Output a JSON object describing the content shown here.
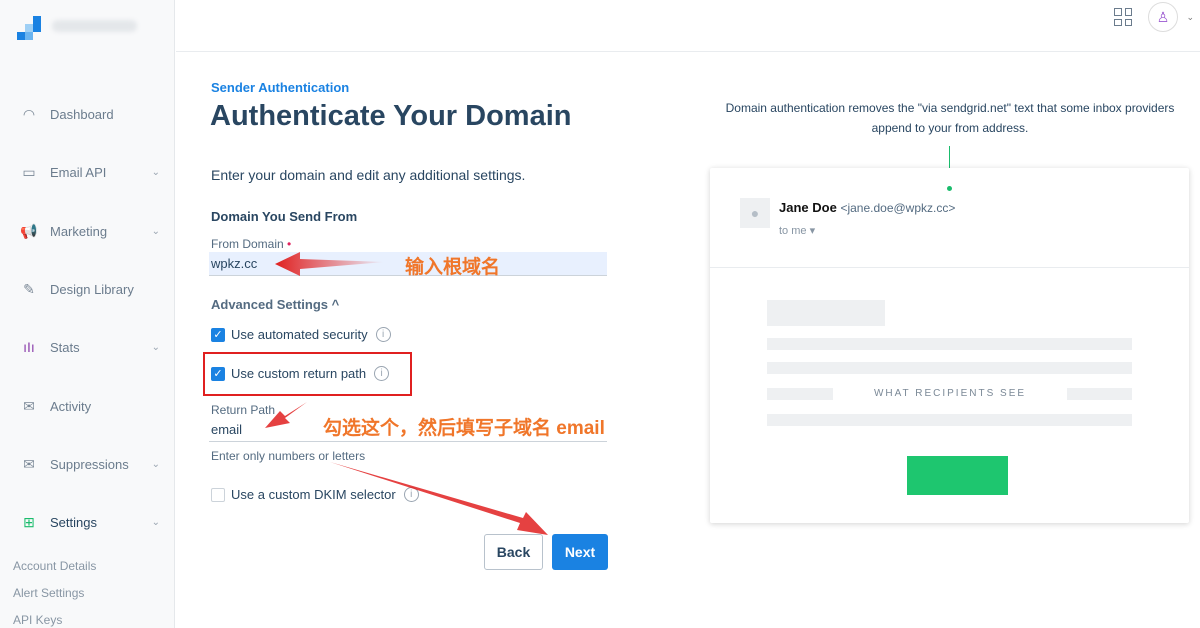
{
  "sidebar": {
    "items": [
      {
        "label": "Dashboard",
        "icon": "gauge-icon"
      },
      {
        "label": "Email API",
        "icon": "terminal-icon"
      },
      {
        "label": "Marketing",
        "icon": "megaphone-icon"
      },
      {
        "label": "Design Library",
        "icon": "pencil-ruler-icon"
      },
      {
        "label": "Stats",
        "icon": "bar-chart-icon"
      },
      {
        "label": "Activity",
        "icon": "envelope-search-icon"
      },
      {
        "label": "Suppressions",
        "icon": "envelope-block-icon"
      },
      {
        "label": "Settings",
        "icon": "sliders-icon"
      }
    ],
    "subitems": [
      "Account Details",
      "Alert Settings",
      "API Keys"
    ]
  },
  "page": {
    "eyebrow": "Sender Authentication",
    "title": "Authenticate Your Domain",
    "intro": "Enter your domain and edit any additional settings.",
    "section": "Domain You Send From",
    "from_domain_label": "From Domain",
    "required_mark": "•",
    "from_domain_value": "wpkz.cc",
    "advanced": "Advanced Settings ^",
    "automated_security": "Use automated security",
    "custom_return_path": "Use custom return path",
    "return_path_label": "Return Path",
    "return_path_value": "email",
    "return_path_hint": "Enter only numbers or letters",
    "dkim": "Use a custom DKIM selector",
    "back": "Back",
    "next": "Next"
  },
  "preview": {
    "description": "Domain authentication removes the \"via sendgrid.net\" text that some inbox providers append to your from address.",
    "sender_name": "Jane Doe",
    "sender_email": "<jane.doe@wpkz.cc>",
    "to": "to me ▾",
    "recipients": "WHAT RECIPIENTS SEE"
  },
  "annotations": {
    "root_domain": "输入根域名",
    "subdomain": "勾选这个，然后填写子域名 email"
  },
  "colors": {
    "accent": "#1a82e2",
    "success": "#1ec66f",
    "annotation": "#f0762a",
    "highlight": "#e02020"
  }
}
